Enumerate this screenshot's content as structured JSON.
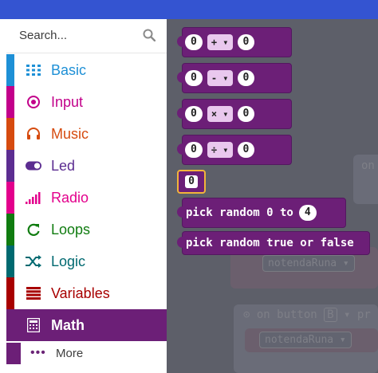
{
  "search": {
    "placeholder": "Search..."
  },
  "categories": [
    {
      "label": "Basic",
      "color": "#1e90d6",
      "icon": "grid-icon"
    },
    {
      "label": "Input",
      "color": "#c2008a",
      "icon": "target-icon"
    },
    {
      "label": "Music",
      "color": "#d64b0f",
      "icon": "headphones-icon"
    },
    {
      "label": "Led",
      "color": "#5c2d91",
      "icon": "toggle-icon"
    },
    {
      "label": "Radio",
      "color": "#e3008c",
      "icon": "signal-bars-icon"
    },
    {
      "label": "Loops",
      "color": "#107c10",
      "icon": "refresh-icon"
    },
    {
      "label": "Logic",
      "color": "#006970",
      "icon": "shuffle-icon"
    },
    {
      "label": "Variables",
      "color": "#a80000",
      "icon": "lines-icon"
    },
    {
      "label": "Math",
      "color": "#6c1f77",
      "icon": "calculator-icon",
      "selected": true
    }
  ],
  "more": {
    "label": "More",
    "icon": "dots-icon"
  },
  "flyout": {
    "arith": [
      {
        "left": "0",
        "op": "+",
        "right": "0"
      },
      {
        "left": "0",
        "op": "-",
        "right": "0"
      },
      {
        "left": "0",
        "op": "×",
        "right": "0"
      },
      {
        "left": "0",
        "op": "÷",
        "right": "0"
      }
    ],
    "number": "0",
    "pick_random": {
      "label_a": "pick random 0 to",
      "value": "4"
    },
    "pick_random_bool": {
      "label": "pick random true or false"
    }
  },
  "workspace": {
    "ghost_on": "on",
    "ghost_var1": "notendaRuna",
    "ghost_on_button": "on button",
    "ghost_button_value": "B",
    "ghost_pr": "pr",
    "ghost_var2": "notendaRuna"
  },
  "colors": {
    "math": "#6c1f77",
    "topbar": "#3454d1"
  }
}
